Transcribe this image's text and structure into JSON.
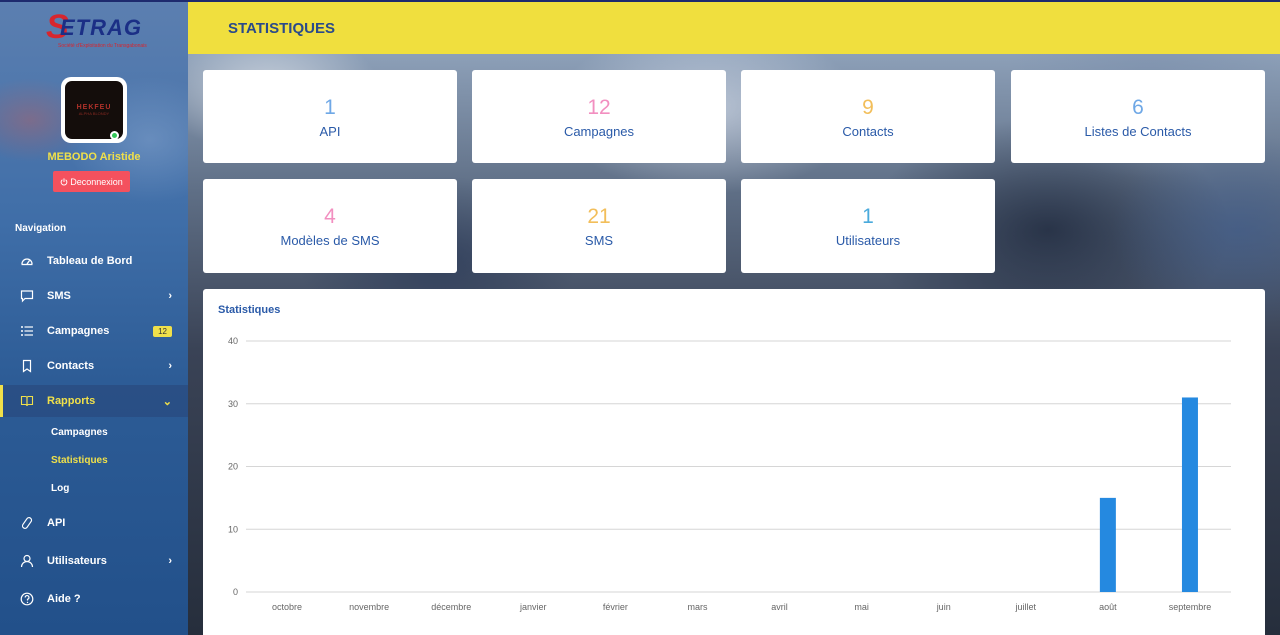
{
  "app": {
    "logo_letter": "S",
    "logo_text": "ETRAG",
    "logo_subtitle": "Société d'Exploitation du Transgabonais"
  },
  "user": {
    "name": "MEBODO Aristide",
    "avatar_text": "HEKFEU",
    "avatar_subtext": "ALPHA BLONDY",
    "logout_label": "Deconnexion"
  },
  "nav": {
    "heading": "Navigation",
    "items": [
      {
        "label": "Tableau de Bord",
        "icon": "dashboard-icon"
      },
      {
        "label": "SMS",
        "icon": "message-icon"
      },
      {
        "label": "Campagnes",
        "icon": "list-icon",
        "badge": "12"
      },
      {
        "label": "Contacts",
        "icon": "bookmark-icon"
      },
      {
        "label": "Rapports",
        "icon": "book-icon"
      },
      {
        "label": "API",
        "icon": "link-icon"
      },
      {
        "label": "Utilisateurs",
        "icon": "user-icon"
      },
      {
        "label": "Aide ?",
        "icon": "help-icon"
      }
    ],
    "rapports_sub": [
      "Campagnes",
      "Statistiques",
      "Log"
    ]
  },
  "header": {
    "title": "STATISTIQUES"
  },
  "stats": [
    {
      "value": "1",
      "label": "API",
      "color": "#6fa8e6"
    },
    {
      "value": "12",
      "label": "Campagnes",
      "color": "#f28fc0"
    },
    {
      "value": "9",
      "label": "Contacts",
      "color": "#f2be5a"
    },
    {
      "value": "6",
      "label": "Listes de Contacts",
      "color": "#6fa8e6"
    },
    {
      "value": "4",
      "label": "Modèles de SMS",
      "color": "#f28fc0"
    },
    {
      "value": "21",
      "label": "SMS",
      "color": "#f2be5a"
    },
    {
      "value": "1",
      "label": "Utilisateurs",
      "color": "#4aaadc"
    }
  ],
  "panel": {
    "title": "Statistiques"
  },
  "chart_data": {
    "type": "bar",
    "categories": [
      "octobre",
      "novembre",
      "décembre",
      "janvier",
      "février",
      "mars",
      "avril",
      "mai",
      "juin",
      "juillet",
      "août",
      "septembre"
    ],
    "values": [
      0,
      0,
      0,
      0,
      0,
      0,
      0,
      0,
      0,
      0,
      15,
      31
    ],
    "yticks": [
      0,
      10,
      20,
      30,
      40
    ],
    "ylim": [
      0,
      40
    ],
    "grid": true,
    "bar_color": "#2589e0"
  }
}
